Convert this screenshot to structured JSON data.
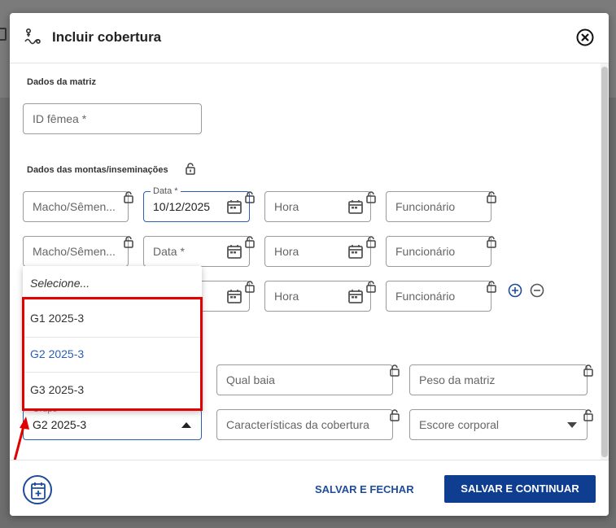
{
  "modal": {
    "title": "Incluir cobertura"
  },
  "section_matriz": {
    "label": "Dados da matriz",
    "id_femea_placeholder": "ID fêmea *"
  },
  "section_montas": {
    "label": "Dados das montas/inseminações",
    "rows": [
      {
        "macho": "Macho/Sêmen...",
        "data_label": "Data *",
        "data_value": "10/12/2025",
        "hora": "Hora",
        "funcionario": "Funcionário"
      },
      {
        "macho": "Macho/Sêmen...",
        "data_placeholder": "Data *",
        "hora": "Hora",
        "funcionario": "Funcionário"
      },
      {
        "hora": "Hora",
        "funcionario": "Funcionário"
      }
    ]
  },
  "section_outros": {
    "qual_baia": "Qual baia",
    "peso_matriz": "Peso da matriz",
    "grupo_label": "Grupo",
    "grupo_value": "G2 2025-3",
    "caracteristicas": "Características da cobertura",
    "escore": "Escore corporal"
  },
  "dropdown": {
    "placeholder": "Selecione...",
    "options": [
      "G1 2025-3",
      "G2 2025-3",
      "G3 2025-3"
    ],
    "selected_color": "#2b5fb4"
  },
  "footer": {
    "save_close": "SALVAR E FECHAR",
    "save_continue": "SALVAR E CONTINUAR"
  },
  "colors": {
    "primary": "#0f3d8f",
    "link": "#1e4c9a",
    "highlight": "#e30000",
    "active_border": "#2b5fb4"
  }
}
